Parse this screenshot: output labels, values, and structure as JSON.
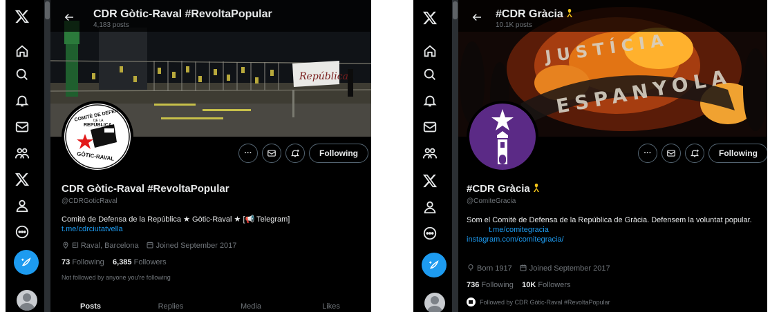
{
  "left": {
    "topbar": {
      "title": "CDR Gòtic-Raval #RevoltaPopular",
      "post_count": "4,183 posts"
    },
    "avatar": {
      "line1": "COMITÈ DE DEFENSA",
      "line2": "DE LA",
      "line3": "REPÚBLICA",
      "line4": "GÒTIC-RAVAL"
    },
    "banner_text": "República",
    "actions": {
      "more": "···",
      "follow_label": "Following"
    },
    "profile": {
      "name": "CDR Gòtic-Raval #RevoltaPopular",
      "handle": "@CDRGoticRaval",
      "bio": "Comitè de Defensa de la República ★ Gòtic-Raval ★ [📢 Telegram]",
      "bio_link": "t.me/cdrciutatvella",
      "location": "El Raval, Barcelona",
      "joined": "Joined September 2017",
      "following_count": "73",
      "following_label": "Following",
      "followers_count": "6,385",
      "followers_label": "Followers",
      "followed_note": "Not followed by anyone you're following"
    },
    "tabs": [
      "Posts",
      "Replies",
      "Media",
      "Likes"
    ]
  },
  "right": {
    "topbar": {
      "title": "#CDR Gràcia",
      "post_count": "10.1K posts"
    },
    "banner_text": {
      "top": "JUSTÍCIA",
      "bottom": "ESPANYOLA"
    },
    "actions": {
      "more": "···",
      "follow_label": "Following"
    },
    "profile": {
      "name": "#CDR Gràcia",
      "handle": "@ComiteGracia",
      "bio": "Som el Comitè de Defensa de la República de Gràcia. Defensem la voluntat popular.",
      "bio_link1": "t.me/comitegracia",
      "bio_link2": "instagram.com/comitegracia/",
      "born": "Born 1917",
      "joined": "Joined September 2017",
      "following_count": "736",
      "following_label": "Following",
      "followers_count": "10K",
      "followers_label": "Followers",
      "followed_note": "Followed by CDR Gòtic-Raval #RevoltaPopular"
    }
  },
  "colors": {
    "accent": "#1d9bf0",
    "muted": "#71767b",
    "ribbon": "#f5c518",
    "purple": "#5b2a86"
  }
}
